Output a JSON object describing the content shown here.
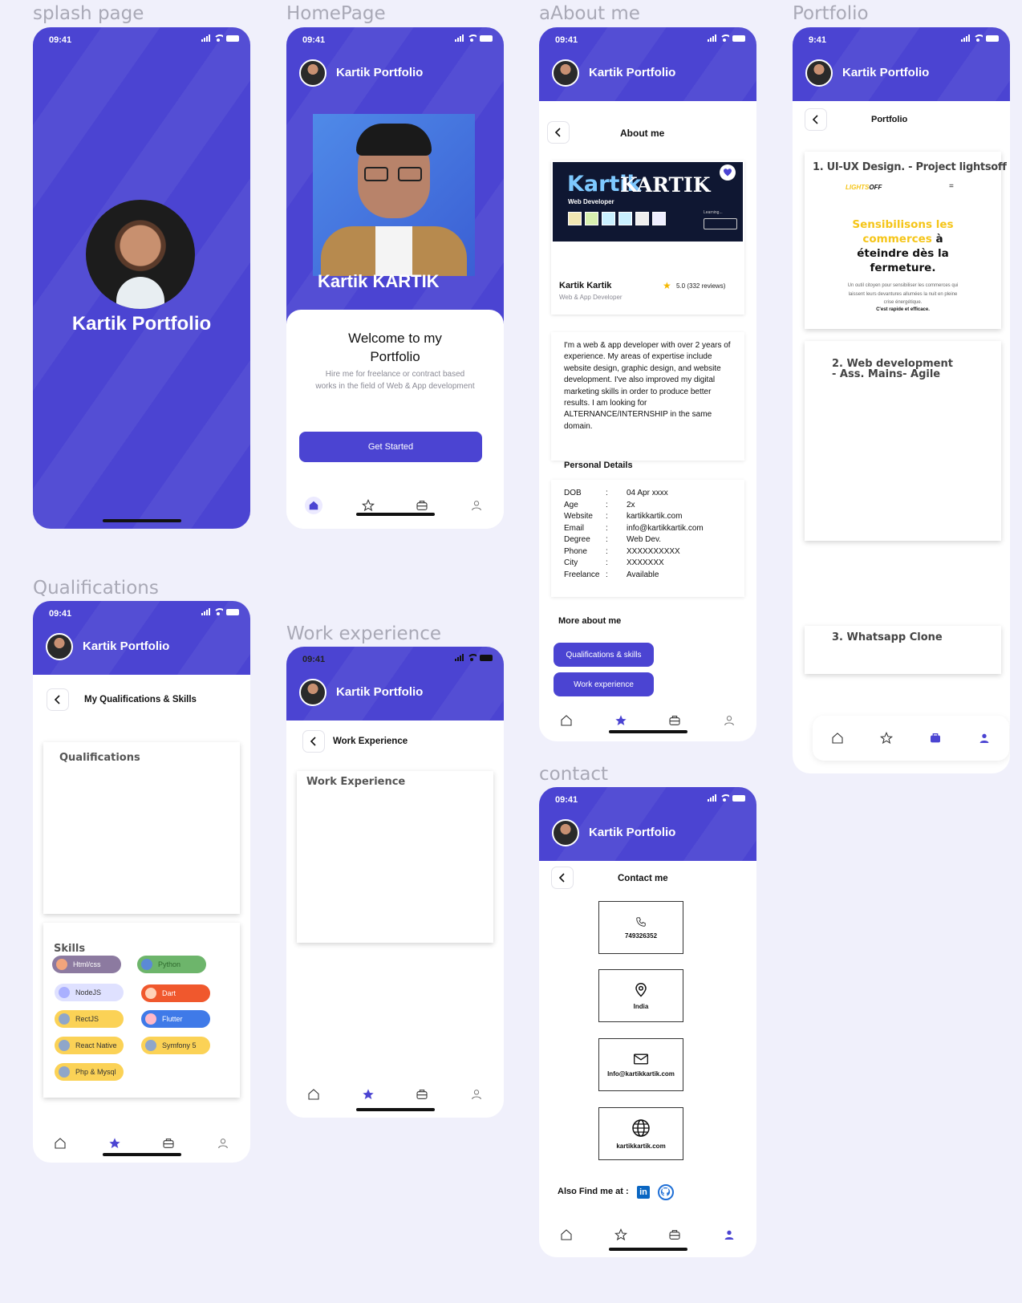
{
  "frames": {
    "splash": "splash page",
    "home": "HomePage",
    "about": "aAbout me",
    "portfolio": "Portfolio",
    "qual": "Qualifications",
    "work": "Work experience",
    "contact": "contact"
  },
  "status": {
    "time": "09:41",
    "time_portfolio": "9:41"
  },
  "app_title": "Kartik Portfolio",
  "splash": {
    "title": "Kartik Portfolio"
  },
  "home": {
    "hero_name": "Kartik KARTIK",
    "welcome": "Welcome to my Portfolio",
    "desc": "Hire me for freelance or contract based works in the field of Web & App development",
    "cta": "Get Started"
  },
  "about": {
    "subtitle": "About me",
    "banner_name1": "Kartik",
    "banner_name2": "KARTIK",
    "banner_role": "Web Developer",
    "banner_learning": "Learning...",
    "profile_name": "Kartik Kartik",
    "profile_role": "Web & App Developer",
    "rating": "5.0 (332 reviews)",
    "bio": "I'm a web & app  developer with over 2 years of experience. My areas of expertise include website design, graphic design, and website development. I've also improved my digital marketing skills in order to produce better results. I am looking for ALTERNANCE/INTERNSHIP in the same domain.",
    "personal_title": "Personal Details",
    "details": [
      {
        "k": "DOB",
        "v": "04 Apr xxxx"
      },
      {
        "k": "Age",
        "v": "2x"
      },
      {
        "k": "Website",
        "v": "kartikkartik.com"
      },
      {
        "k": "Email",
        "v": "info@kartikkartik.com"
      },
      {
        "k": "Degree",
        "v": "Web Dev."
      },
      {
        "k": "Phone",
        "v": "XXXXXXXXXX"
      },
      {
        "k": "City",
        "v": "XXXXXXX"
      },
      {
        "k": "Freelance",
        "v": "Available"
      }
    ],
    "sep": ":",
    "more_title": "More about me",
    "btn_qual": "Qualifications & skills",
    "btn_work": "Work experience"
  },
  "portfolio": {
    "subtitle": "Portfolio",
    "p1_title": "1. UI-UX Design. -  Project lightsoff",
    "p1_logo_a": "LIGHTS",
    "p1_logo_b": "OFF",
    "p1_menu": "=",
    "p1_h1": "Sensibilisons les commerces",
    "p1_h2": "à",
    "p1_h3": "éteindre dès la fermeture.",
    "p1_small": "Un outil citoyen pour sensibiliser les commerces qui laissent leurs devantures allumées la nuit en pleine crise énergétique.",
    "p1_bold": "C'est rapide et efficace.",
    "p2_title": "2. Web development - Ass. Mains- Agile",
    "p3_title": "3. Whatsapp Clone"
  },
  "qual": {
    "subtitle": "My Qualifications & Skills",
    "card_title": "Qualifications",
    "skills_title": "Skills",
    "skills": [
      "Html/css",
      "Python",
      "NodeJS",
      "Dart",
      "RectJS",
      "Flutter",
      "React Native",
      "Symfony 5",
      "Php & Mysql"
    ]
  },
  "work": {
    "subtitle": "Work Experience",
    "card_title": "Work Experience"
  },
  "contact": {
    "subtitle": "Contact me",
    "phone": "749326352",
    "country": "India",
    "email": "Info@kartikkartik.com",
    "site": "kartikkartik.com",
    "find": "Also Find me at :",
    "linkedin": "in"
  },
  "colors": {
    "primary": "#4b44d2",
    "background": "#f0f0fb"
  },
  "icons": [
    "home-icon",
    "star-icon",
    "briefcase-icon",
    "user-icon",
    "chevron-left-icon",
    "heart-icon",
    "phone-icon",
    "location-icon",
    "mail-icon",
    "globe-icon",
    "github-icon",
    "linkedin-icon"
  ]
}
